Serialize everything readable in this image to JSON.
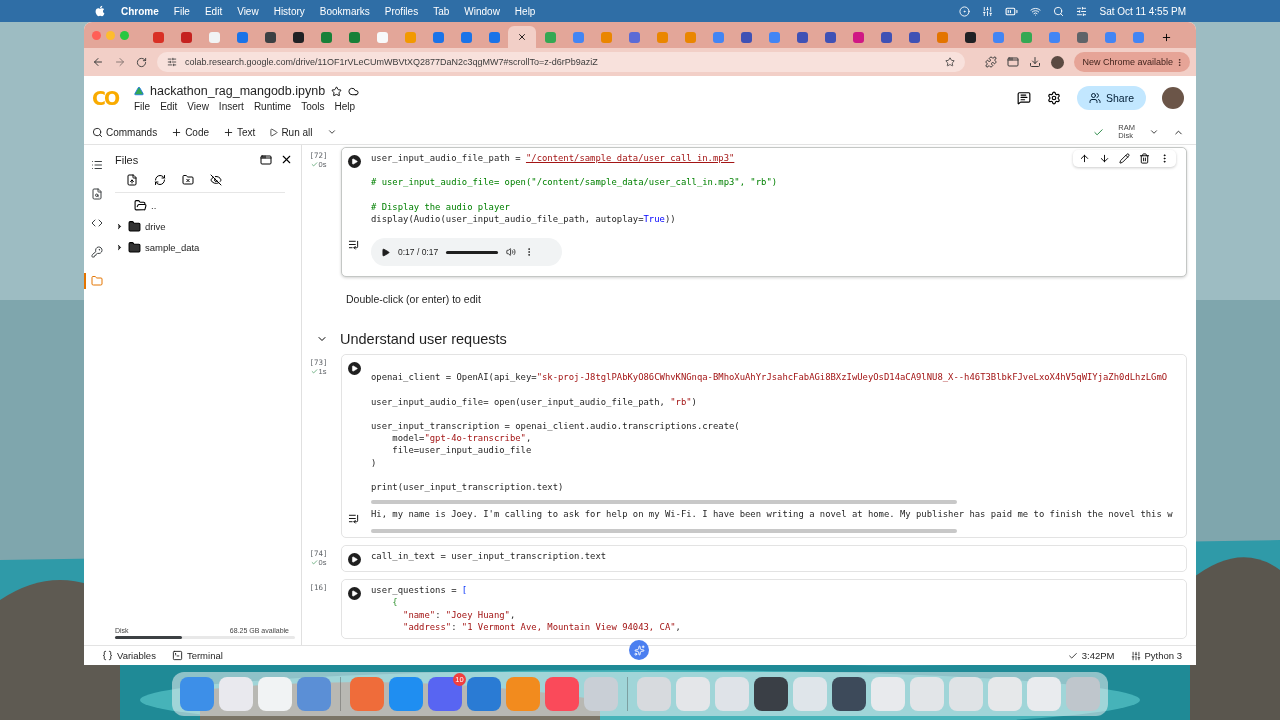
{
  "menubar": {
    "app": "Chrome",
    "menus": [
      "File",
      "Edit",
      "View",
      "History",
      "Bookmarks",
      "Profiles",
      "Tab",
      "Window",
      "Help"
    ],
    "clock": "Sat Oct 11  4:55 PM"
  },
  "browser": {
    "tabs": [
      {
        "selected": false,
        "color": "#d93025"
      },
      {
        "selected": false,
        "color": "#c5221f"
      },
      {
        "selected": false,
        "color": "#f1f3f4"
      },
      {
        "selected": false,
        "color": "#1a73e8"
      },
      {
        "selected": false,
        "color": "#3c4043"
      },
      {
        "selected": false,
        "color": "#202124"
      },
      {
        "selected": false,
        "color": "#188038"
      },
      {
        "selected": false,
        "color": "#188038"
      },
      {
        "selected": false,
        "color": "#f8f9fa"
      },
      {
        "selected": false,
        "color": "#f29900"
      },
      {
        "selected": false,
        "color": "#1a73e8"
      },
      {
        "selected": false,
        "color": "#1a73e8"
      },
      {
        "selected": false,
        "color": "#1a73e8"
      },
      {
        "selected": true
      },
      {
        "selected": false,
        "color": "#34a853"
      },
      {
        "selected": false,
        "color": "#4285f4"
      },
      {
        "selected": false,
        "color": "#ea8600"
      },
      {
        "selected": false,
        "color": "#5b6bd6"
      },
      {
        "selected": false,
        "color": "#ea8600"
      },
      {
        "selected": false,
        "color": "#ea8600"
      },
      {
        "selected": false,
        "color": "#4285f4"
      },
      {
        "selected": false,
        "color": "#3f51b5"
      },
      {
        "selected": false,
        "color": "#4285f4"
      },
      {
        "selected": false,
        "color": "#3f51b5"
      },
      {
        "selected": false,
        "color": "#3f51b5"
      },
      {
        "selected": false,
        "color": "#d01884"
      },
      {
        "selected": false,
        "color": "#3f51b5"
      },
      {
        "selected": false,
        "color": "#3f51b5"
      },
      {
        "selected": false,
        "color": "#e37400"
      },
      {
        "selected": false,
        "color": "#202124"
      },
      {
        "selected": false,
        "color": "#4285f4"
      },
      {
        "selected": false,
        "color": "#34a853"
      },
      {
        "selected": false,
        "color": "#4285f4"
      },
      {
        "selected": false,
        "color": "#5f6368"
      },
      {
        "selected": false,
        "color": "#4285f4"
      },
      {
        "selected": false,
        "color": "#4285f4"
      }
    ],
    "url": "colab.research.google.com/drive/11OF1rVLeCUmWBVtXQ2877DaN2c3qgMW7#scrollTo=z-d6rPb9aziZ",
    "update_button": "New Chrome available"
  },
  "colab": {
    "logo": "CO",
    "title": "hackathon_rag_mangodb.ipynb",
    "menus": [
      "File",
      "Edit",
      "View",
      "Insert",
      "Runtime",
      "Tools",
      "Help"
    ],
    "share": "Share",
    "toolbar": {
      "commands": "Commands",
      "code": "Code",
      "text": "Text",
      "run_all": "Run all"
    },
    "resources": {
      "ram": "RAM",
      "disk": "Disk"
    }
  },
  "rail": [
    {
      "kind": "toc",
      "selected": false
    },
    {
      "kind": "search",
      "selected": false
    },
    {
      "kind": "snippets",
      "selected": false
    },
    {
      "kind": "secrets",
      "selected": false
    },
    {
      "kind": "files",
      "selected": true
    }
  ],
  "sidebar": {
    "title": "Files",
    "tree": [
      {
        "name": "..",
        "kind": "parent"
      },
      {
        "name": "drive",
        "kind": "folder",
        "expanded": false
      },
      {
        "name": "sample_data",
        "kind": "folder",
        "expanded": false
      }
    ],
    "disk": {
      "label": "Disk",
      "available": "68.25 GB available",
      "level": 0.37
    }
  },
  "notebook": [
    {
      "kind": "code",
      "count": "[72]",
      "duration": "0s",
      "selected": true,
      "lines": [
        {
          "kind": "code",
          "tokens": [
            {
              "text": "user_input_audio_file_path = ",
              "kind": "plain"
            },
            {
              "text": "\"/content/sample_data/user_call_in.mp3\"",
              "kind": "path"
            }
          ]
        },
        {
          "kind": "blank"
        },
        {
          "kind": "code",
          "tokens": [
            {
              "text": "# user_input_audio_file= open(\"/content/sample_data/user_call_in.mp3\", \"rb\")",
              "kind": "comment"
            }
          ]
        },
        {
          "kind": "blank"
        },
        {
          "kind": "code",
          "tokens": [
            {
              "text": "# Display the audio player",
              "kind": "comment"
            }
          ]
        },
        {
          "kind": "code",
          "tokens": [
            {
              "text": "display(Audio(user_input_audio_file_path, autoplay=",
              "kind": "plain"
            },
            {
              "text": "True",
              "kind": "keyword"
            },
            {
              "text": "))",
              "kind": "plain"
            }
          ]
        }
      ],
      "output": {
        "kind": "audio",
        "time": "0:17 / 0:17",
        "level": 1
      }
    },
    {
      "kind": "text",
      "text": "Double-click (or enter) to edit"
    },
    {
      "kind": "section",
      "title": "Understand user requests",
      "expanded": true
    },
    {
      "kind": "code",
      "count": "[73]",
      "duration": "1s",
      "selected": false,
      "lines": [
        {
          "kind": "blank"
        },
        {
          "kind": "code",
          "tokens": [
            {
              "text": "openai_client = OpenAI(api_key=",
              "kind": "plain"
            },
            {
              "text": "\"sk-proj-J8tglPAbKyO86CWhvKNGnqa-BMhoXuAhYrJsahcFabAGi8BXzIwUeyOsD14aCA9lNU8_X--h46T3BlbkFJveLxoX4hV5qWIYjaZh0dLhzLGmO",
              "kind": "string"
            }
          ]
        },
        {
          "kind": "blank"
        },
        {
          "kind": "code",
          "tokens": [
            {
              "text": "user_input_audio_file= open(user_input_audio_file_path, ",
              "kind": "plain"
            },
            {
              "text": "\"rb\"",
              "kind": "string"
            },
            {
              "text": ")",
              "kind": "plain"
            }
          ]
        },
        {
          "kind": "blank"
        },
        {
          "kind": "code",
          "tokens": [
            {
              "text": "user_input_transcription = openai_client.audio.transcriptions.create(",
              "kind": "plain"
            }
          ]
        },
        {
          "kind": "code",
          "tokens": [
            {
              "text": "    model=",
              "kind": "plain"
            },
            {
              "text": "\"gpt-4o-transcribe\"",
              "kind": "string"
            },
            {
              "text": ",",
              "kind": "plain"
            }
          ]
        },
        {
          "kind": "code",
          "tokens": [
            {
              "text": "    file=user_input_audio_file",
              "kind": "plain"
            }
          ]
        },
        {
          "kind": "code",
          "tokens": [
            {
              "text": ")",
              "kind": "plain"
            }
          ]
        },
        {
          "kind": "blank"
        },
        {
          "kind": "code",
          "tokens": [
            {
              "text": "print(user_input_transcription.text)",
              "kind": "plain"
            }
          ]
        }
      ],
      "output": {
        "kind": "stream",
        "text": "Hi, my name is Joey. I'm calling to ask for help on my Wi-Fi. I have been writing a novel at home. My publisher has paid me to finish the novel this w"
      }
    },
    {
      "kind": "code",
      "count": "[74]",
      "duration": "0s",
      "selected": false,
      "lines": [
        {
          "kind": "code",
          "tokens": [
            {
              "text": "call_in_text = user_input_transcription.text",
              "kind": "plain"
            }
          ]
        }
      ]
    },
    {
      "kind": "code",
      "count": "[16]",
      "selected": false,
      "lines": [
        {
          "kind": "code",
          "tokens": [
            {
              "text": "user_questions = ",
              "kind": "plain"
            },
            {
              "text": "[",
              "kind": "bracket"
            }
          ]
        },
        {
          "kind": "code",
          "tokens": [
            {
              "text": "    {",
              "kind": "brace"
            }
          ]
        },
        {
          "kind": "code",
          "tokens": [
            {
              "text": "      \"name\"",
              "kind": "string"
            },
            {
              "text": ": ",
              "kind": "plain"
            },
            {
              "text": "\"Joey Huang\"",
              "kind": "string"
            },
            {
              "text": ",",
              "kind": "plain"
            }
          ]
        },
        {
          "kind": "code",
          "tokens": [
            {
              "text": "      \"address\"",
              "kind": "string"
            },
            {
              "text": ": ",
              "kind": "plain"
            },
            {
              "text": "\"1 Vermont Ave, Mountain View 94043, CA\"",
              "kind": "string"
            },
            {
              "text": ",",
              "kind": "plain"
            }
          ]
        }
      ]
    }
  ],
  "status_bar": {
    "variables": "Variables",
    "terminal": "Terminal",
    "time": "3:42PM",
    "runtime": "Python 3"
  },
  "dock": [
    {
      "kind": "app",
      "color": "#3d8fe8"
    },
    {
      "kind": "app",
      "color": "#e9e9ee"
    },
    {
      "kind": "app",
      "color": "#f1f3f4"
    },
    {
      "kind": "app",
      "color": "#5b8fd6"
    },
    {
      "kind": "separator"
    },
    {
      "kind": "app",
      "color": "#ef6c3a"
    },
    {
      "kind": "app",
      "color": "#1f8ef1"
    },
    {
      "kind": "app",
      "color": "#5865f2",
      "badge": "10"
    },
    {
      "kind": "app",
      "color": "#2a7bd4"
    },
    {
      "kind": "app",
      "color": "#f28b1e"
    },
    {
      "kind": "app",
      "color": "#fa4a5a"
    },
    {
      "kind": "app",
      "color": "#c9cfd6"
    },
    {
      "kind": "separator"
    },
    {
      "kind": "app",
      "color": "#d7dade"
    },
    {
      "kind": "app",
      "color": "#e4e6e9"
    },
    {
      "kind": "app",
      "color": "#dfe3e8"
    },
    {
      "kind": "app",
      "color": "#3a3f46"
    },
    {
      "kind": "app",
      "color": "#dfe5ea"
    },
    {
      "kind": "app",
      "color": "#3d4a5a"
    },
    {
      "kind": "app",
      "color": "#e8eaed"
    },
    {
      "kind": "app",
      "color": "#e2e5e8"
    },
    {
      "kind": "app",
      "color": "#dfe3e6"
    },
    {
      "kind": "app",
      "color": "#e6e8ea"
    },
    {
      "kind": "app",
      "color": "#e9ebee"
    },
    {
      "kind": "app",
      "color": "#bfc6cc"
    }
  ]
}
